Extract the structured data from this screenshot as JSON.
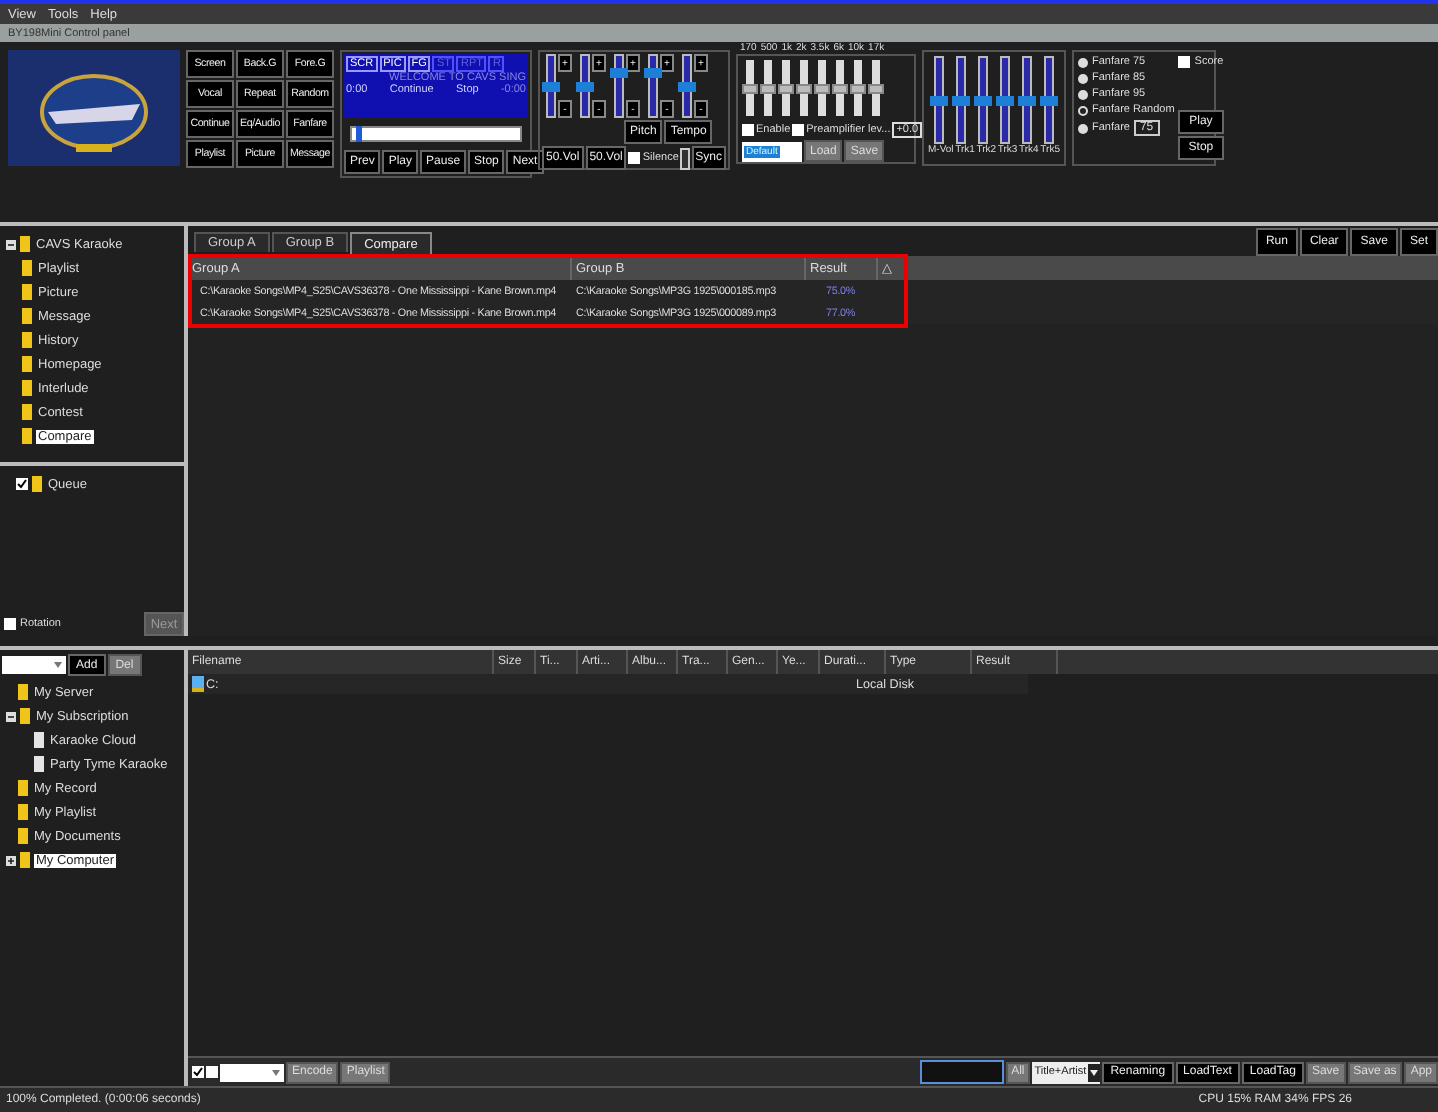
{
  "menu": [
    "View",
    "Tools",
    "Help"
  ],
  "window": {
    "title": "BY198Mini Control panel"
  },
  "control_panel": {
    "mode_buttons": [
      "Screen",
      "Back.G",
      "Fore.G",
      "Vocal",
      "Repeat",
      "Random",
      "Continue",
      "Eq/Audio",
      "Fanfare",
      "Playlist",
      "Picture",
      "Message"
    ],
    "indicators": [
      {
        "label": "SCR",
        "on": true
      },
      {
        "label": "PIC",
        "on": true
      },
      {
        "label": "FG",
        "on": true
      },
      {
        "label": "ST",
        "on": false
      },
      {
        "label": "RPT",
        "on": false
      },
      {
        "label": "R",
        "on": false
      }
    ],
    "marquee": "WELCOME TO CAVS SING",
    "time_elapsed": "0:00",
    "next_mode": "Continue",
    "end_mode": "Stop",
    "time_remaining": "-0:00",
    "progress": {
      "level": 0.02
    },
    "transport": [
      "Prev",
      "Play",
      "Pause",
      "Stop",
      "Next"
    ],
    "volume_sliders": [
      {
        "level": 0.5,
        "plus": "+",
        "minus": "-"
      },
      {
        "level": 0.5,
        "plus": "+",
        "minus": "-"
      },
      {
        "level": 0.75,
        "plus": "+",
        "minus": "-"
      },
      {
        "level": 0.75,
        "plus": "+",
        "minus": "-"
      },
      {
        "level": 0.5,
        "plus": "+",
        "minus": "-"
      }
    ],
    "pitch": "Pitch",
    "tempo": "Tempo",
    "vol_buttons": [
      "50.Vol",
      "50.Vol"
    ],
    "silence": {
      "label": "Silence",
      "checked": false
    },
    "sync": "Sync",
    "eq": {
      "bands": [
        {
          "label": "170",
          "level": 0.5
        },
        {
          "label": "500",
          "level": 0.5
        },
        {
          "label": "1k",
          "level": 0.5
        },
        {
          "label": "2k",
          "level": 0.5
        },
        {
          "label": "3.5k",
          "level": 0.5
        },
        {
          "label": "6k",
          "level": 0.5
        },
        {
          "label": "10k",
          "level": 0.5
        },
        {
          "label": "17k",
          "level": 0.5
        }
      ],
      "enable": {
        "label": "Enable",
        "checked": false
      },
      "preamp": {
        "label": "Preamplifier lev...",
        "checked": false
      },
      "preamp_value": "+0.0",
      "preset": "Default",
      "load": "Load",
      "save": "Save"
    },
    "mixer": [
      {
        "label": "M-Vol",
        "level": 0.5
      },
      {
        "label": "Trk1",
        "level": 0.5
      },
      {
        "label": "Trk2",
        "level": 0.5
      },
      {
        "label": "Trk3",
        "level": 0.5
      },
      {
        "label": "Trk4",
        "level": 0.5
      },
      {
        "label": "Trk5",
        "level": 0.5
      }
    ],
    "fanfare": {
      "options": [
        {
          "label": "Fanfare 75",
          "selected": false
        },
        {
          "label": "Fanfare 85",
          "selected": false
        },
        {
          "label": "Fanfare 95",
          "selected": false
        },
        {
          "label": "Fanfare Random",
          "selected": true
        },
        {
          "label": "Fanfare",
          "selected": false
        }
      ],
      "custom_value": "75",
      "score": {
        "label": "Score",
        "checked": false
      },
      "play": "Play",
      "stop": "Stop"
    }
  },
  "sidebar": {
    "tree": [
      {
        "label": "CAVS Karaoke",
        "expanded": true,
        "selected": false,
        "children": [
          {
            "label": "Playlist",
            "selected": false
          },
          {
            "label": "Picture",
            "selected": false
          },
          {
            "label": "Message",
            "selected": false
          },
          {
            "label": "History",
            "selected": false
          },
          {
            "label": "Homepage",
            "selected": false
          },
          {
            "label": "Interlude",
            "selected": false
          },
          {
            "label": "Contest",
            "selected": false
          },
          {
            "label": "Compare",
            "selected": true
          }
        ]
      }
    ],
    "queue": [
      {
        "label": "Queue",
        "checked": true
      }
    ],
    "rotation": {
      "label": "Rotation",
      "checked": false
    },
    "next": {
      "label": "Next",
      "disabled": true
    }
  },
  "compare": {
    "tabs": [
      {
        "label": "Group A",
        "selected": false
      },
      {
        "label": "Group B",
        "selected": false
      },
      {
        "label": "Compare",
        "selected": true
      }
    ],
    "actions": [
      "Run",
      "Clear",
      "Save",
      "Set"
    ],
    "table": {
      "columns": [
        "Group A",
        "Group B",
        "Result",
        "△"
      ],
      "rows": [
        {
          "group_a": "C:\\Karaoke Songs\\MP4_S25\\CAVS36378 - One Mississippi - Kane Brown.mp4",
          "group_b": "C:\\Karaoke Songs\\MP3G 1925\\000185.mp3",
          "result": "75.0%"
        },
        {
          "group_a": "C:\\Karaoke Songs\\MP4_S25\\CAVS36378 - One Mississippi - Kane Brown.mp4",
          "group_b": "C:\\Karaoke Songs\\MP3G 1925\\000089.mp3",
          "result": "77.0%"
        }
      ]
    }
  },
  "explorer": {
    "add": "Add",
    "del": "Del",
    "tree": [
      {
        "label": "My Server",
        "kind": "folder",
        "selected": false
      },
      {
        "label": "My Subscription",
        "kind": "folder",
        "selected": false,
        "expanded": true,
        "children": [
          {
            "label": "Karaoke Cloud",
            "kind": "page",
            "selected": false
          },
          {
            "label": "Party Tyme Karaoke",
            "kind": "page",
            "selected": false
          }
        ]
      },
      {
        "label": "My Record",
        "kind": "folder",
        "selected": false
      },
      {
        "label": "My Playlist",
        "kind": "folder",
        "selected": false
      },
      {
        "label": "My Documents",
        "kind": "folder",
        "selected": false
      },
      {
        "label": "My Computer",
        "kind": "folder",
        "selected": true,
        "expanded": false
      }
    ],
    "columns": [
      "Filename",
      "Size",
      "Ti...",
      "Arti...",
      "Albu...",
      "Tra...",
      "Gen...",
      "Ye...",
      "Durati...",
      "Type",
      "Result"
    ],
    "rows": [
      {
        "filename": "C:",
        "type": "Local Disk"
      }
    ],
    "bottom_left": {
      "checks": [
        {
          "checked": true
        },
        {
          "checked": false
        }
      ],
      "encode": "Encode",
      "playlist": "Playlist"
    },
    "bottom_right": {
      "all": "All",
      "mode": "Title+Artist",
      "buttons": [
        {
          "label": "Renaming",
          "kind": "dark"
        },
        {
          "label": "LoadText",
          "kind": "dark"
        },
        {
          "label": "LoadTag",
          "kind": "dark"
        },
        {
          "label": "Save",
          "kind": "grey"
        },
        {
          "label": "Save as",
          "kind": "grey"
        },
        {
          "label": "App",
          "kind": "grey"
        }
      ]
    }
  },
  "status_bar": {
    "message": "100% Completed. (0:00:06 seconds)",
    "stats": "CPU 15% RAM 34% FPS 26"
  }
}
